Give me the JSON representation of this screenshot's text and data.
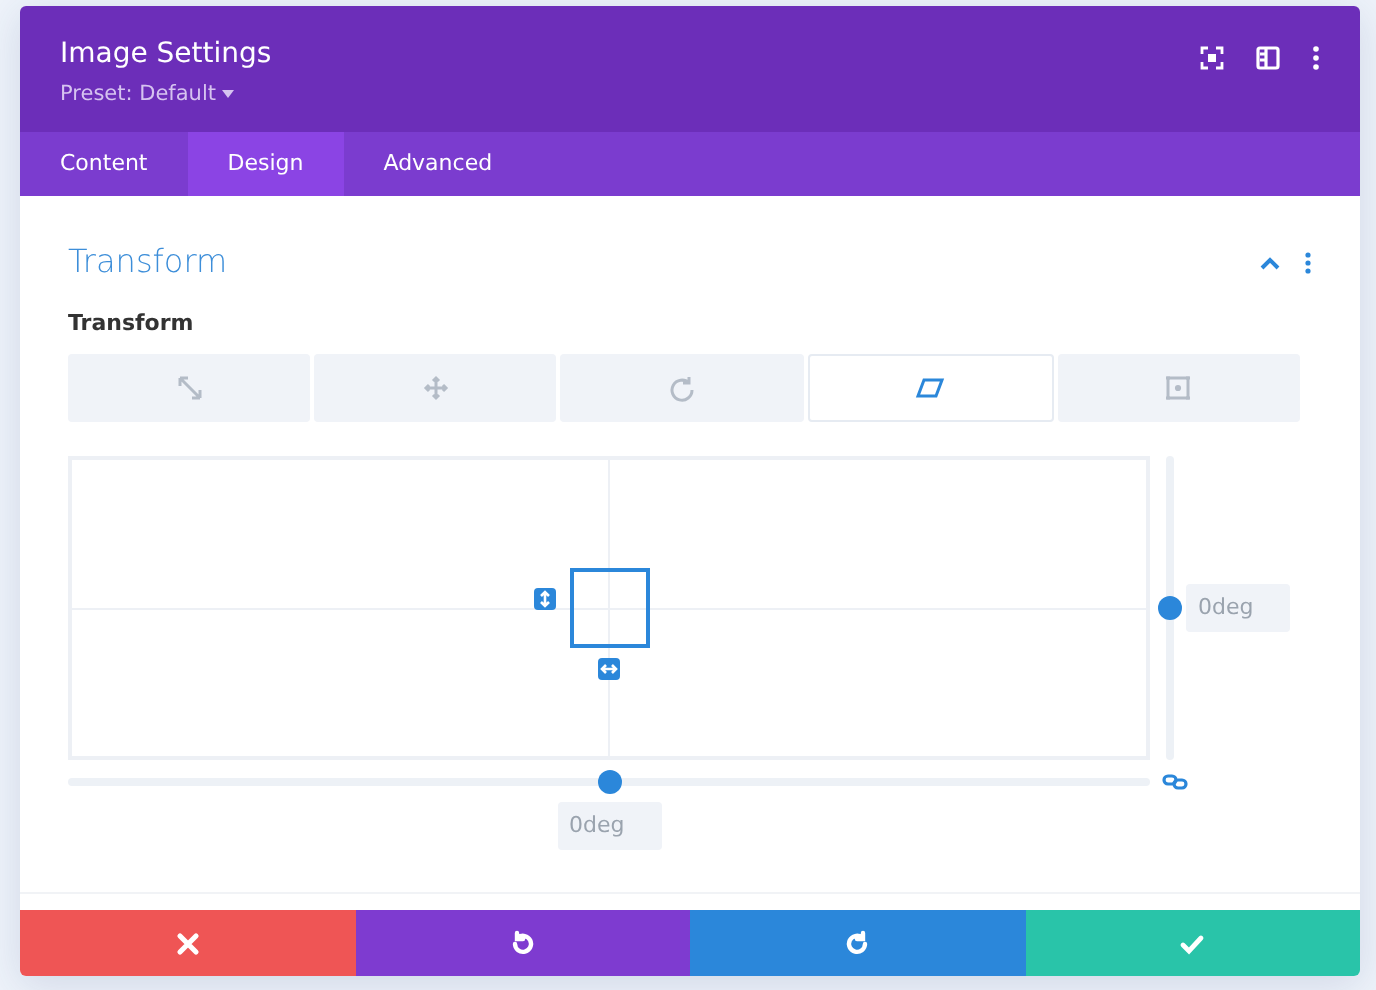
{
  "window": {
    "title": "Image Settings",
    "preset": "Preset: Default"
  },
  "tabs": [
    {
      "label": "Content",
      "selected": false
    },
    {
      "label": "Design",
      "selected": true
    },
    {
      "label": "Advanced",
      "selected": false
    }
  ],
  "section": {
    "title": "Transform",
    "expanded": true
  },
  "field": {
    "label": "Transform"
  },
  "transform_tabs": [
    {
      "kind": "scale",
      "selected": false
    },
    {
      "kind": "translate",
      "selected": false
    },
    {
      "kind": "rotate",
      "selected": false
    },
    {
      "kind": "skew",
      "selected": true
    },
    {
      "kind": "origin",
      "selected": false
    }
  ],
  "skew": {
    "y_slider": {
      "level": 0.5,
      "value": "0deg"
    },
    "x_slider": {
      "level": 0.5,
      "value": "0deg"
    }
  },
  "footer_buttons": [
    {
      "kind": "cancel"
    },
    {
      "kind": "undo"
    },
    {
      "kind": "redo"
    },
    {
      "kind": "save"
    }
  ]
}
